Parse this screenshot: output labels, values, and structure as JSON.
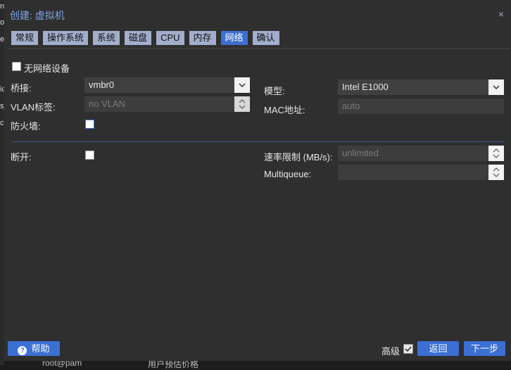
{
  "background": {
    "left_letters": [
      "n",
      "oi",
      "er",
      "ic",
      "s_",
      "c"
    ],
    "bottom_text_1": "root@pam",
    "bottom_text_2": "用户预估价格"
  },
  "dialog": {
    "title": "创建: 虚拟机",
    "close_glyph": "×"
  },
  "tabs": [
    {
      "label": "常规",
      "active": false
    },
    {
      "label": "操作系统",
      "active": false
    },
    {
      "label": "系统",
      "active": false
    },
    {
      "label": "磁盘",
      "active": false
    },
    {
      "label": "CPU",
      "active": false
    },
    {
      "label": "内存",
      "active": false
    },
    {
      "label": "网络",
      "active": true
    },
    {
      "label": "确认",
      "active": false
    }
  ],
  "form": {
    "no_network_label": "无网络设备",
    "bridge_label": "桥接:",
    "bridge_value": "vmbr0",
    "vlan_label": "VLAN标签:",
    "vlan_placeholder": "no VLAN",
    "firewall_label": "防火墙:",
    "model_label": "模型:",
    "model_value": "Intel E1000",
    "mac_label": "MAC地址:",
    "mac_placeholder": "auto",
    "disconnect_label": "断开:",
    "rate_label": "速率限制 (MB/s):",
    "rate_placeholder": "unlimited",
    "multiqueue_label": "Multiqueue:"
  },
  "footer": {
    "help_label": "帮助",
    "help_icon": "question-icon",
    "advanced_label": "高级",
    "advanced_checked": true,
    "back_label": "返回",
    "next_label": "下一步"
  },
  "colors": {
    "accent": "#3b6fd3",
    "tab_inactive": "#a3aecd",
    "dialog_bg": "#2f2f2f"
  }
}
